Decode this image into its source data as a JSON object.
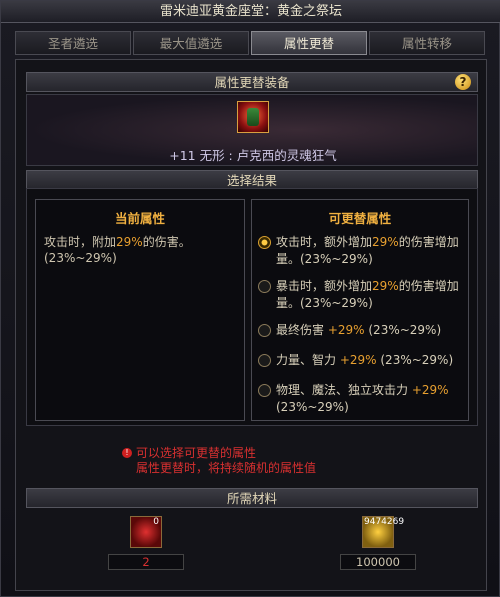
{
  "window": {
    "title": "雷米迪亚黄金座堂：黄金之祭坛"
  },
  "tabs": [
    {
      "label": "圣者遴选",
      "active": false
    },
    {
      "label": "最大值遴选",
      "active": false
    },
    {
      "label": "属性更替",
      "active": true
    },
    {
      "label": "属性转移",
      "active": false
    }
  ],
  "equip_section": {
    "header": "属性更替装备",
    "item_name": "+11 无形 : 卢克西的灵魂狂气"
  },
  "result_section": {
    "header": "选择结果",
    "current": {
      "title": "当前属性",
      "text_prefix": "攻击时，附加",
      "value": "29%",
      "text_suffix": "的伤害。(23%~29%)"
    },
    "options_title": "可更替属性",
    "options": [
      {
        "prefix": "攻击时，额外增加",
        "value": "29%",
        "suffix": "的伤害增加量。(23%~29%)",
        "selected": true
      },
      {
        "prefix": "暴击时，额外增加",
        "value": "29%",
        "suffix": "的伤害增加量。(23%~29%)",
        "selected": false
      },
      {
        "prefix": "最终伤害 ",
        "value": "+29%",
        "suffix": " (23%~29%)",
        "selected": false
      },
      {
        "prefix": "力量、智力 ",
        "value": "+29%",
        "suffix": " (23%~29%)",
        "selected": false
      },
      {
        "prefix": "物理、魔法、独立攻击力 ",
        "value": "+29%",
        "suffix": " (23%~29%)",
        "selected": false
      }
    ]
  },
  "warning": {
    "line1": "可以选择可更替的属性",
    "line2": "属性更替时，将持续随机的属性值"
  },
  "materials": {
    "header": "所需材料",
    "items": [
      {
        "icon": "red-crystal-icon",
        "badge": "0",
        "amount": "2"
      },
      {
        "icon": "gold-coin-icon",
        "badge": "9474269",
        "amount": "100000"
      }
    ]
  },
  "colors": {
    "highlight": "#e8a030",
    "title_gold": "#f0b040",
    "warning_red": "#d83030"
  }
}
